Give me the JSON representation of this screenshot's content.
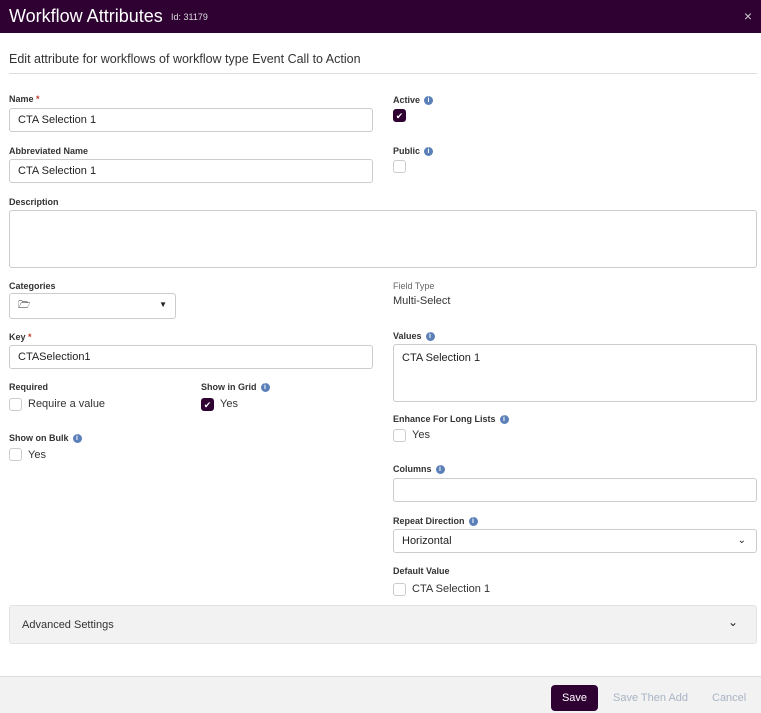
{
  "header": {
    "title": "Workflow Attributes",
    "id_label": "Id: 31179",
    "close": "×"
  },
  "subtitle": "Edit attribute for workflows of workflow type Event Call to Action",
  "fields": {
    "name": {
      "label": "Name",
      "required": "*",
      "value": "CTA Selection 1"
    },
    "abbreviated_name": {
      "label": "Abbreviated Name",
      "value": "CTA Selection 1"
    },
    "active": {
      "label": "Active",
      "checked": true
    },
    "public": {
      "label": "Public",
      "checked": false
    },
    "description": {
      "label": "Description",
      "value": ""
    },
    "categories": {
      "label": "Categories",
      "icon": "folder-open-icon"
    },
    "field_type": {
      "label": "Field Type",
      "value": "Multi-Select"
    },
    "key": {
      "label": "Key",
      "required": "*",
      "value": "CTASelection1"
    },
    "values": {
      "label": "Values",
      "value": "CTA Selection 1"
    },
    "required": {
      "label": "Required",
      "option": "Require a value",
      "checked": false
    },
    "show_in_grid": {
      "label": "Show in Grid",
      "option": "Yes",
      "checked": true
    },
    "show_on_bulk": {
      "label": "Show on Bulk",
      "option": "Yes",
      "checked": false
    },
    "enhance": {
      "label": "Enhance For Long Lists",
      "option": "Yes",
      "checked": false
    },
    "columns": {
      "label": "Columns",
      "value": ""
    },
    "repeat_direction": {
      "label": "Repeat Direction",
      "value": "Horizontal"
    },
    "default_value": {
      "label": "Default Value",
      "option": "CTA Selection 1",
      "checked": false
    }
  },
  "advanced": {
    "label": "Advanced Settings"
  },
  "footer": {
    "save": "Save",
    "save_then_add": "Save Then Add",
    "cancel": "Cancel"
  },
  "colors": {
    "brand": "#2f0133",
    "info": "#5b7fb8"
  }
}
